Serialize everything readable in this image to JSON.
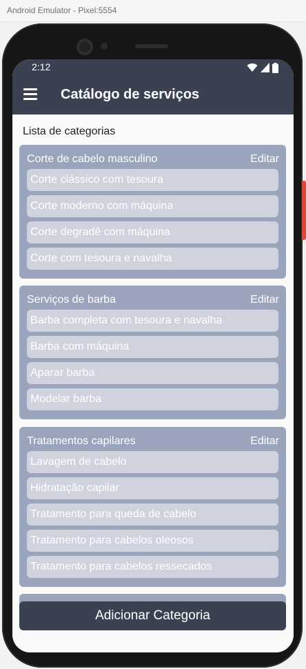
{
  "window": {
    "title": "Android Emulator - Pixel:5554"
  },
  "status_bar": {
    "time": "2:12",
    "icons": [
      "wifi-icon",
      "signal-icon",
      "battery-icon"
    ]
  },
  "app_bar": {
    "menu_icon": "hamburger-menu-icon",
    "title": "Catálogo de serviços"
  },
  "content": {
    "heading": "Lista de categorias",
    "edit_label": "Editar",
    "categories": [
      {
        "name": "Corte de cabelo masculino",
        "edit_label": "Editar",
        "services": [
          "Corte clássico com tesoura",
          "Corte moderno com máquina",
          "Corte degradê com máquina",
          "Corte com tesoura e navalha"
        ]
      },
      {
        "name": "Serviços de barba",
        "edit_label": "Editar",
        "services": [
          "Barba completa com tesoura e navalha",
          "Barba com máquina",
          "Aparar barba",
          "Modelar barba"
        ]
      },
      {
        "name": "Tratamentos capilares",
        "edit_label": "Editar",
        "services": [
          "Lavagem de cabelo",
          "Hidratação capilar",
          "Tratamento para queda de cabelo",
          "Tratamento para cabelos oleosos",
          "Tratamento para cabelos ressecados"
        ]
      }
    ],
    "add_button_label": "Adicionar Categoria"
  },
  "colors": {
    "app_bar": "#3a4252",
    "card": "#9aa4bc",
    "item": "#d0d3de",
    "button": "#3a4252",
    "background": "#fafafa"
  }
}
